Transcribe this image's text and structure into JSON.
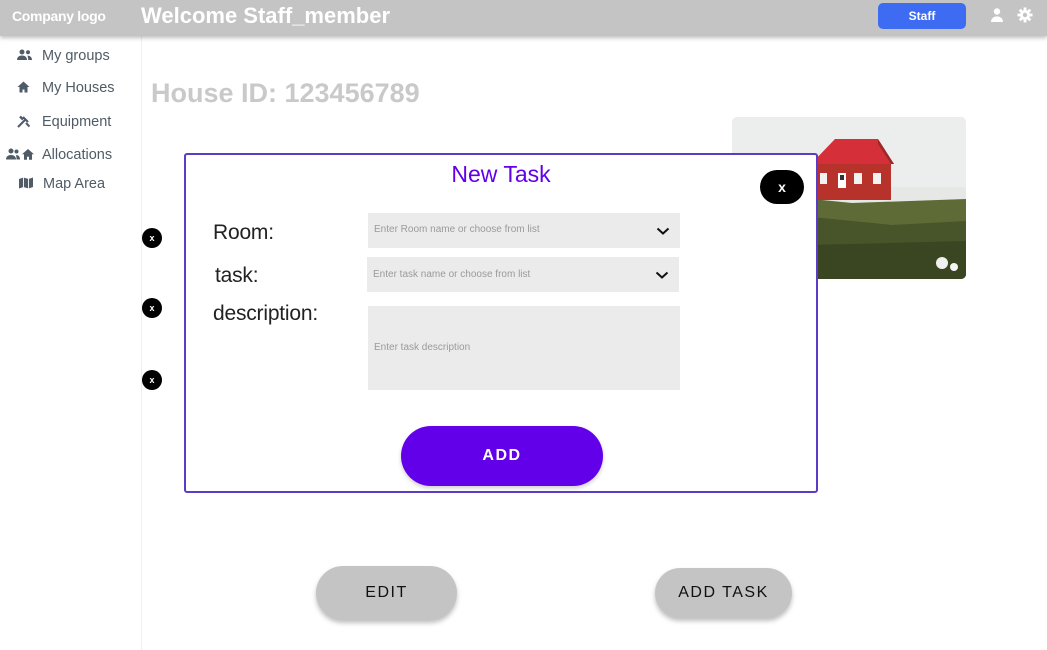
{
  "header": {
    "logo_text": "Company logo",
    "welcome_text": "Welcome Staff_member",
    "role_button": "Staff",
    "user_icon": "user-icon",
    "settings_icon": "gear-icon"
  },
  "sidebar": {
    "items": [
      {
        "label": "My groups",
        "icon": "groups-icon"
      },
      {
        "label": "My Houses",
        "icon": "house-icon"
      },
      {
        "label": "Equipment",
        "icon": "tools-icon"
      },
      {
        "label": "Allocations",
        "icon": "allocations-icon"
      },
      {
        "label": "Map Area",
        "icon": "map-icon"
      }
    ]
  },
  "main": {
    "house_title": "House ID: 123456789",
    "remove_button_label": "x",
    "edit_button": "EDIT",
    "add_task_button": "ADD TASK"
  },
  "modal": {
    "title": "New Task",
    "close_label": "x",
    "room_label": "Room:",
    "room_placeholder": "Enter Room name or choose from list",
    "task_label": "task:",
    "task_placeholder": "Enter task name or choose from list",
    "description_label": "description:",
    "description_placeholder": "Enter task description",
    "add_button": "ADD"
  },
  "colors": {
    "header_bg": "#c4c4c4",
    "accent_purple": "#6200ea",
    "staff_blue": "#3d6cf2",
    "sidebar_text": "#4f5b66"
  }
}
